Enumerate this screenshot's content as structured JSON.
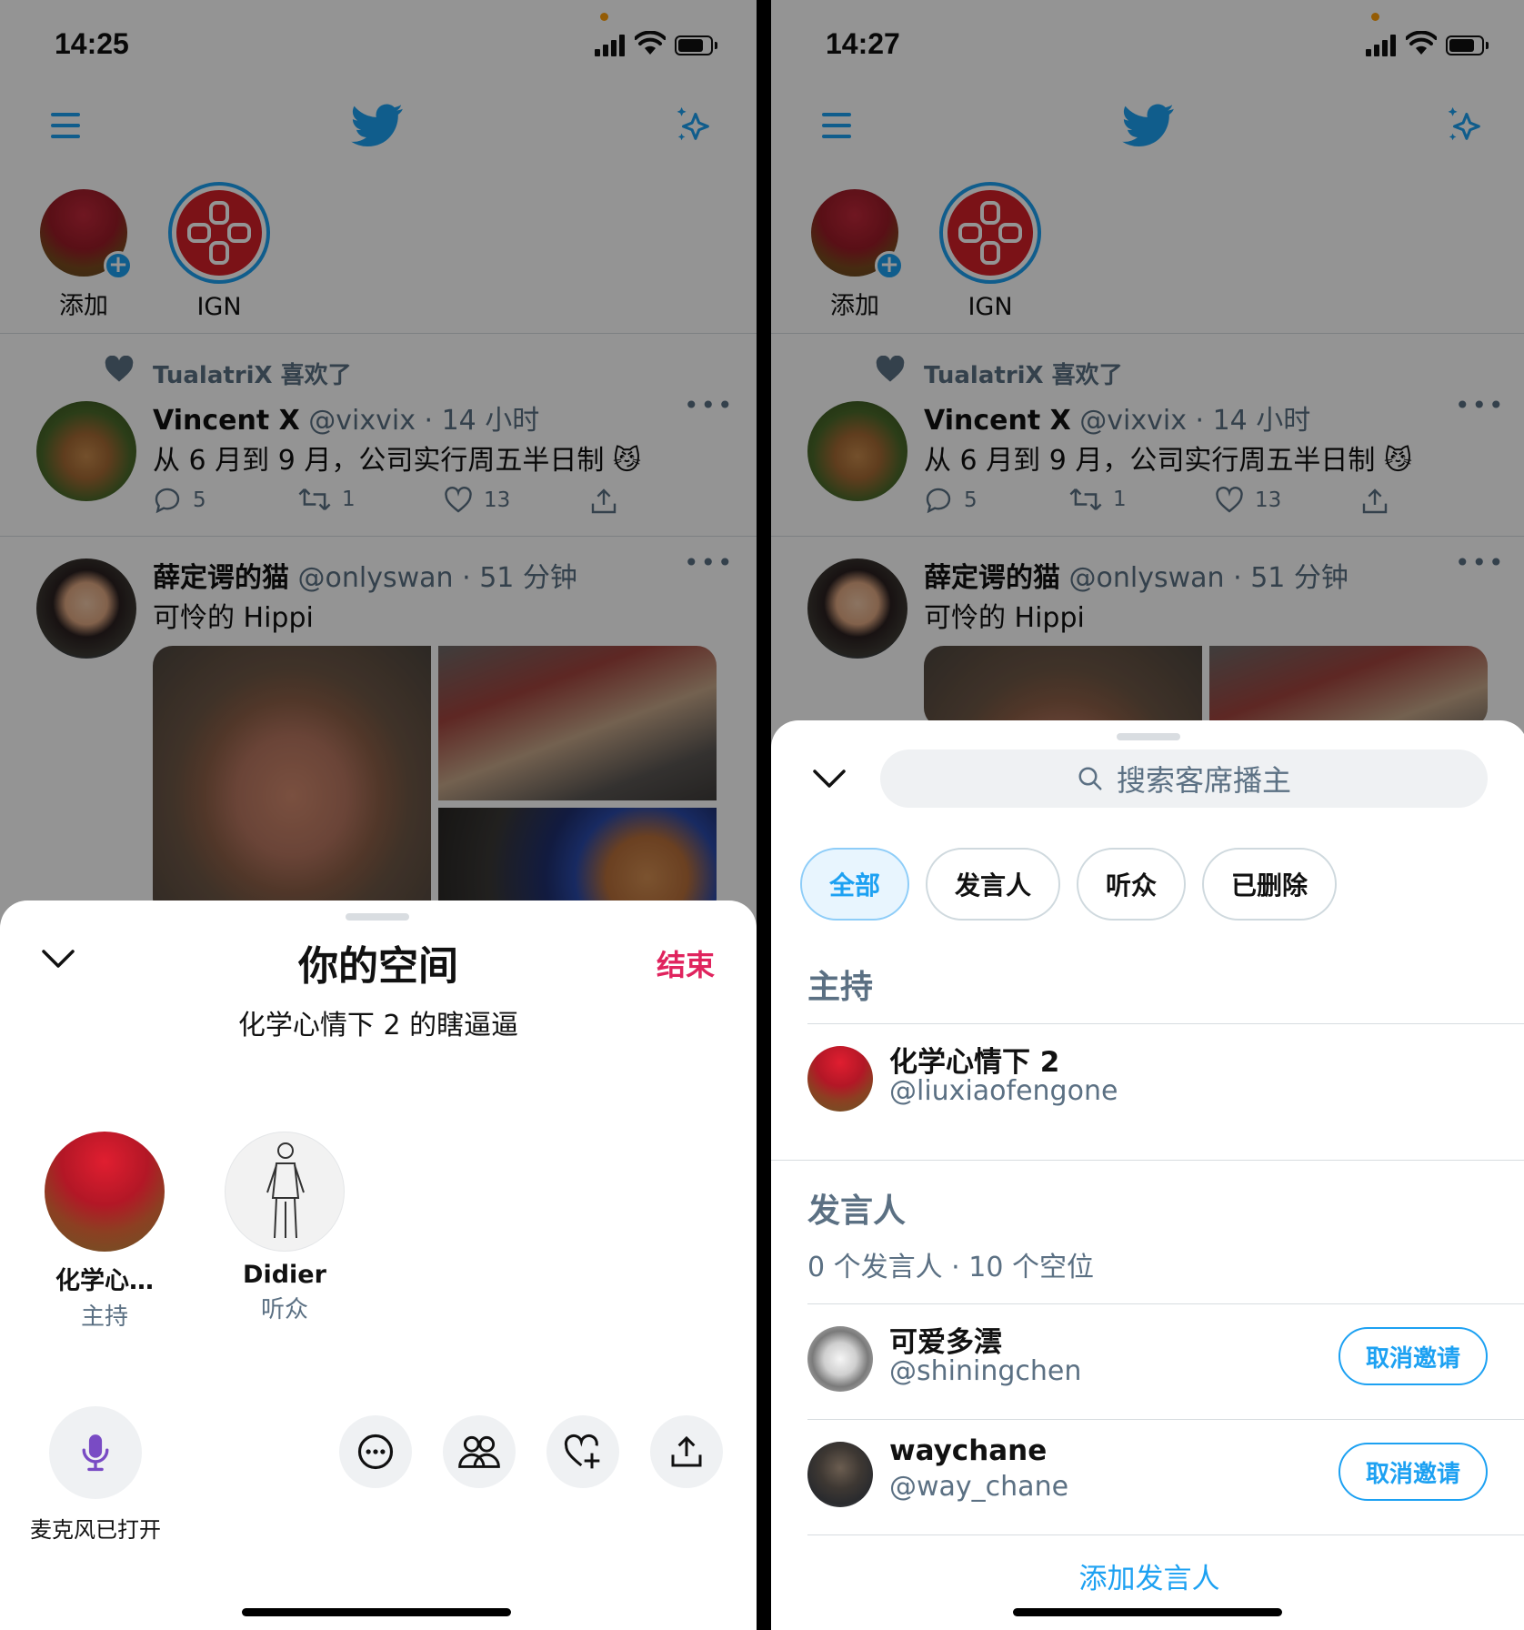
{
  "left": {
    "status": {
      "time": "14:25"
    },
    "fleets": [
      {
        "label": "添加"
      },
      {
        "label": "IGN"
      }
    ],
    "tweet1": {
      "social": "TualatriX 喜欢了",
      "name": "Vincent X",
      "handle": "@vixvix",
      "time": "· 14 小时",
      "text": "从 6 月到 9 月，公司实行周五半日制",
      "emoji": "😼",
      "replies": "5",
      "retweets": "1",
      "likes": "13"
    },
    "tweet2": {
      "name": "薛定谔的猫",
      "handle": "@onlyswan",
      "time": "· 51 分钟",
      "text": "可怜的 Hippi"
    },
    "sheet": {
      "title": "你的空间",
      "end_label": "结束",
      "subtitle": "化学心情下 2 的瞎逼逼",
      "participants": [
        {
          "name": "化学心…",
          "role": "主持"
        },
        {
          "name": "Didier",
          "role": "听众"
        }
      ],
      "mic_label": "麦克风已打开"
    }
  },
  "right": {
    "status": {
      "time": "14:27"
    },
    "fleets": [
      {
        "label": "添加"
      },
      {
        "label": "IGN"
      }
    ],
    "tweet1": {
      "social": "TualatriX 喜欢了",
      "name": "Vincent X",
      "handle": "@vixvix",
      "time": "· 14 小时",
      "text": "从 6 月到 9 月，公司实行周五半日制",
      "emoji": "😼",
      "replies": "5",
      "retweets": "1",
      "likes": "13"
    },
    "tweet2": {
      "name": "薛定谔的猫",
      "handle": "@onlyswan",
      "time": "· 51 分钟",
      "text": "可怜的 Hippi"
    },
    "sheet": {
      "search_placeholder": "搜索客席播主",
      "tabs": [
        "全部",
        "发言人",
        "听众",
        "已删除"
      ],
      "host_section": "主持",
      "host": {
        "name": "化学心情下 2",
        "handle": "@liuxiaofengone"
      },
      "speaker_section": "发言人",
      "speaker_summary": "0 个发言人 · 10 个空位",
      "invitees": [
        {
          "name": "可爱多澐",
          "handle": "@shiningchen",
          "action": "取消邀请"
        },
        {
          "name": "waychane",
          "handle": "@way_chane",
          "action": "取消邀请"
        }
      ],
      "add_speaker": "添加发言人"
    }
  },
  "colors": {
    "twitter_blue": "#1da1f2",
    "end_red": "#e0245e",
    "secondary_text": "#5b7083",
    "mic_purple": "#794bc4"
  }
}
